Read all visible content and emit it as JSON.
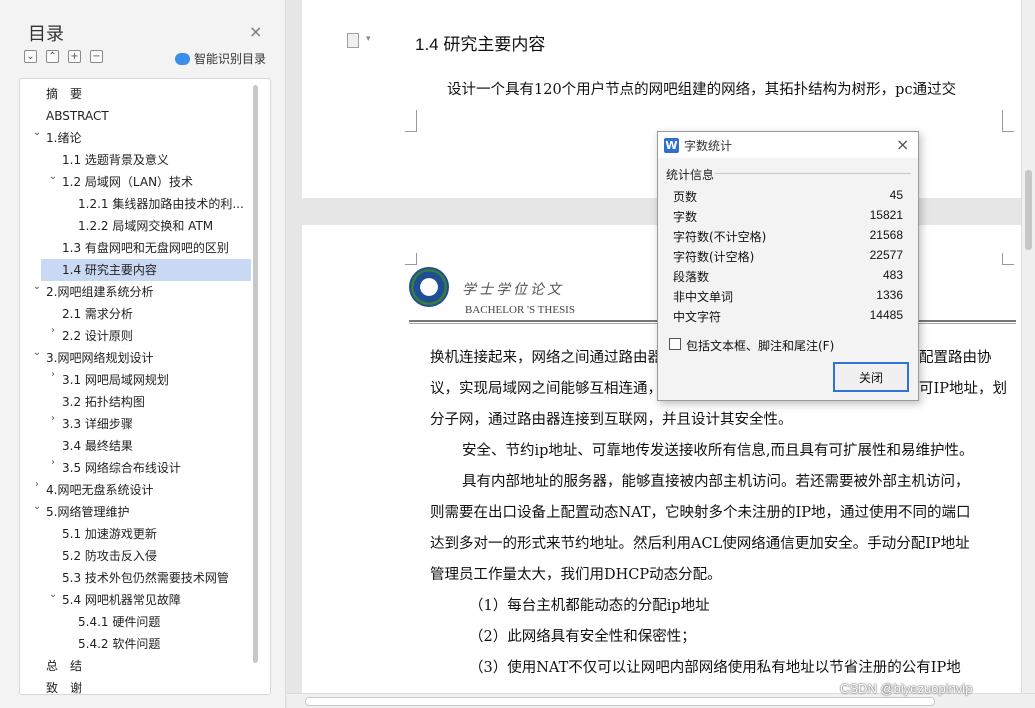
{
  "nav": {
    "title": "目录",
    "close_glyph": "×",
    "smart_toc_label": "智能识别目录",
    "toc": [
      {
        "label": "摘　要",
        "level": 0,
        "arrow": ""
      },
      {
        "label": "ABSTRACT",
        "level": 0,
        "arrow": ""
      },
      {
        "label": "1.绪论",
        "level": 0,
        "arrow": "down"
      },
      {
        "label": "1.1 选题背景及意义",
        "level": 1,
        "arrow": ""
      },
      {
        "label": "1.2 局域网（LAN）技术",
        "level": 1,
        "arrow": "down"
      },
      {
        "label": "1.2.1 集线器加路由技术的利...",
        "level": 2,
        "arrow": ""
      },
      {
        "label": "1.2.2 局域网交换和 ATM",
        "level": 2,
        "arrow": ""
      },
      {
        "label": "1.3 有盘网吧和无盘网吧的区别",
        "level": 1,
        "arrow": ""
      },
      {
        "label": "1.4 研究主要内容",
        "level": 1,
        "arrow": "",
        "active": true
      },
      {
        "label": "2.网吧组建系统分析",
        "level": 0,
        "arrow": "down"
      },
      {
        "label": "2.1 需求分析",
        "level": 1,
        "arrow": ""
      },
      {
        "label": "2.2 设计原则",
        "level": 1,
        "arrow": "right"
      },
      {
        "label": "3.网吧网络规划设计",
        "level": 0,
        "arrow": "down"
      },
      {
        "label": "3.1 网吧局域网规划",
        "level": 1,
        "arrow": "right"
      },
      {
        "label": "3.2 拓扑结构图",
        "level": 1,
        "arrow": ""
      },
      {
        "label": "3.3 详细步骤",
        "level": 1,
        "arrow": "right"
      },
      {
        "label": "3.4 最终结果",
        "level": 1,
        "arrow": ""
      },
      {
        "label": "3.5 网络综合布线设计",
        "level": 1,
        "arrow": "right"
      },
      {
        "label": "4.网吧无盘系统设计",
        "level": 0,
        "arrow": "right"
      },
      {
        "label": "5.网络管理维护",
        "level": 0,
        "arrow": "down"
      },
      {
        "label": "5.1 加速游戏更新",
        "level": 1,
        "arrow": ""
      },
      {
        "label": "5.2 防攻击反入侵",
        "level": 1,
        "arrow": ""
      },
      {
        "label": "5.3 技术外包仍然需要技术网管",
        "level": 1,
        "arrow": ""
      },
      {
        "label": "5.4 网吧机器常见故障",
        "level": 1,
        "arrow": "down"
      },
      {
        "label": "5.4.1 硬件问题",
        "level": 2,
        "arrow": ""
      },
      {
        "label": "5.4.2 软件问题",
        "level": 2,
        "arrow": ""
      },
      {
        "label": "总　结",
        "level": 0,
        "arrow": ""
      },
      {
        "label": "致　谢",
        "level": 0,
        "arrow": ""
      }
    ]
  },
  "document": {
    "heading": "1.4 研究主要内容",
    "paragraph_top": "设计一个具有120个用户节点的网吧组建的网络，其拓扑结构为树形，pc通过交",
    "header_cn": "学士学位论文",
    "header_en": "BACHELOR 'S THESIS",
    "lines": [
      "换机连接起来，网络之间通过路由器",
      "议，实现局域网之间能够互相连通，",
      "分子网，通过路由器连接到互联网，并且设计其安全性。",
      "安全、节约ip地址、可靠地传发送接收所有信息,而且具有可扩展性和易维护性。",
      "具有内部地址的服务器，能够直接被内部主机访问。若还需要被外部主机访问，",
      "则需要在出口设备上配置动态NAT，它映射多个未注册的IP地，通过使用不同的端口",
      "达到多对一的形式来节约地址。然后利用ACL使网络通信更加安全。手动分配IP地址",
      "管理员工作量太大，我们用DHCP动态分配。",
      "（1）每台主机都能动态的分配ip地址",
      "（2）此网络具有安全性和保密性；",
      "（3）使用NAT不仅可以让网吧内部网络使用私有地址以节省注册的公有IP地"
    ],
    "line_tail_1": "配置路由协",
    "line_tail_2": "可IP地址，划"
  },
  "dialog": {
    "title": "字数统计",
    "icon_letter": "W",
    "close_glyph": "×",
    "group_label": "统计信息",
    "stats": [
      {
        "label": "页数",
        "value": "45"
      },
      {
        "label": "字数",
        "value": "15821"
      },
      {
        "label": "字符数(不计空格)",
        "value": "21568"
      },
      {
        "label": "字符数(计空格)",
        "value": "22577"
      },
      {
        "label": "段落数",
        "value": "483"
      },
      {
        "label": "非中文单词",
        "value": "1336"
      },
      {
        "label": "中文字符",
        "value": "14485"
      }
    ],
    "checkbox_label": "包括文本框、脚注和尾注(F)",
    "close_button": "关闭"
  },
  "watermark": "CSDN @biyezuopinvip",
  "colors": {
    "accent": "#2f72d8",
    "toc_active": "#c9d9f3"
  }
}
